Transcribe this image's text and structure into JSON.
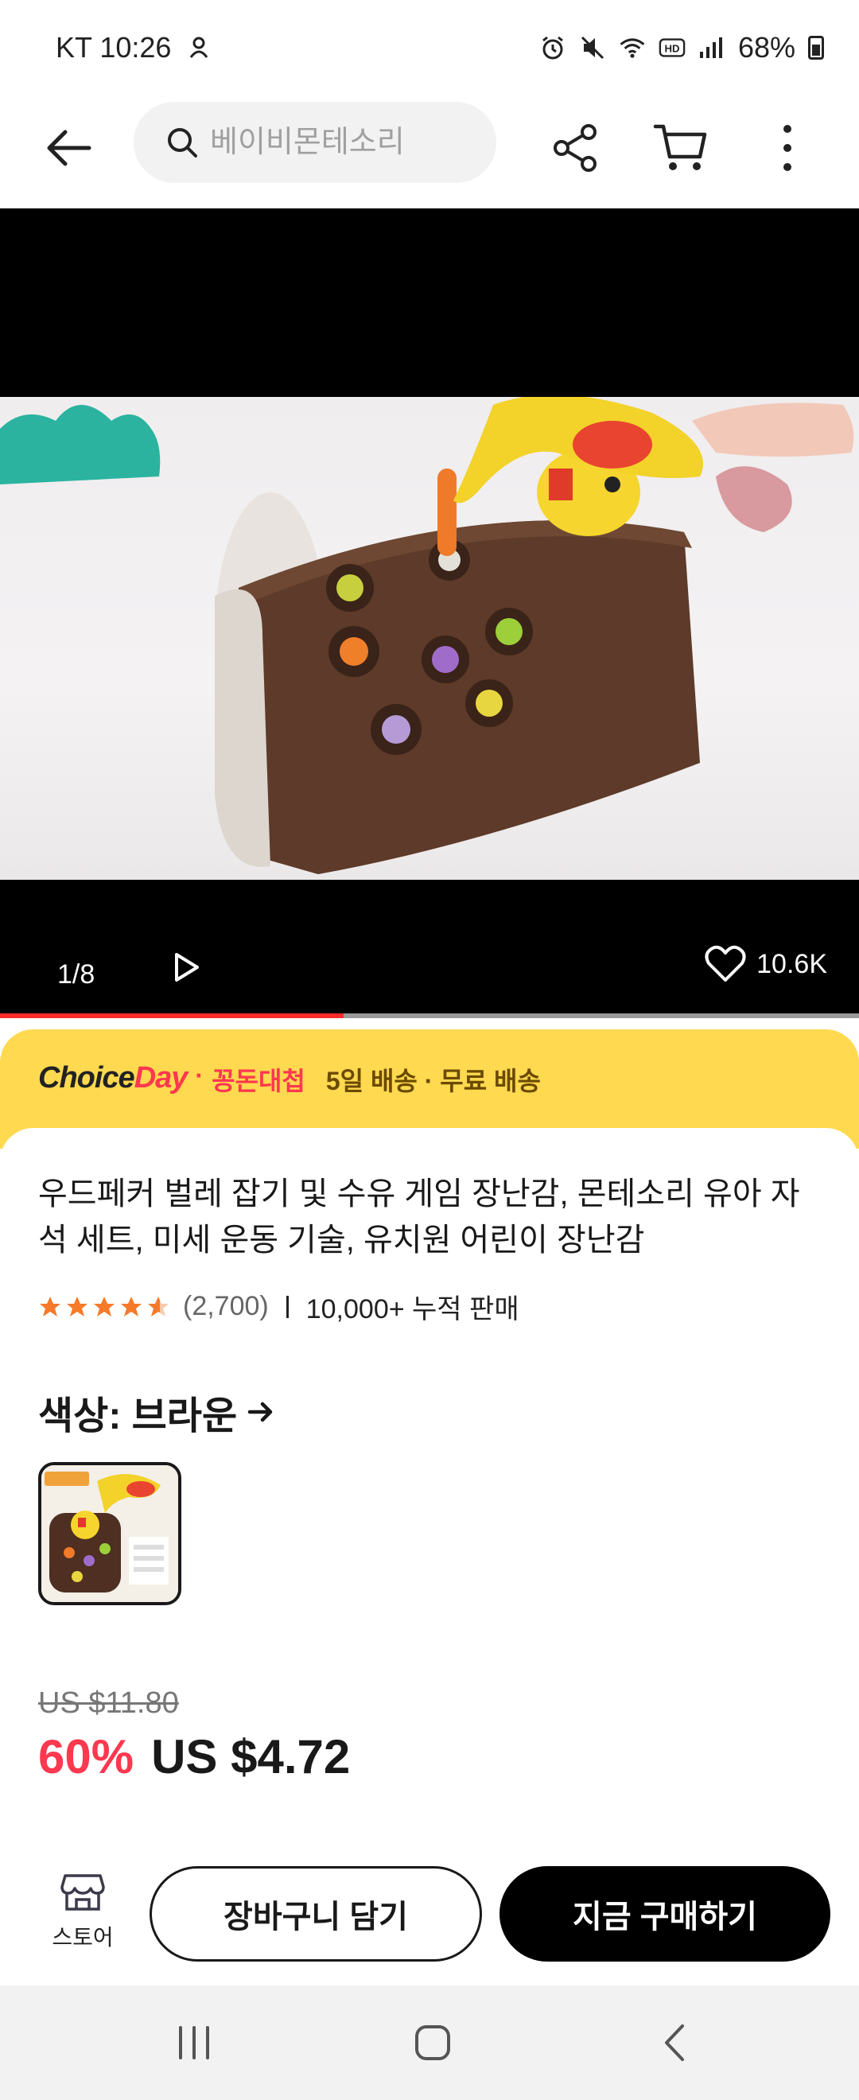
{
  "status_bar": {
    "carrier_time": "KT 10:26",
    "battery": "68%",
    "icons": [
      "alarm-icon",
      "mute-icon",
      "wifi-icon",
      "hd-icon",
      "signal-icon",
      "battery-icon"
    ]
  },
  "header": {
    "search_placeholder": "베이비몬테소리",
    "icons": [
      "back-arrow-icon",
      "search-icon",
      "share-icon",
      "cart-icon",
      "more-vertical-icon"
    ]
  },
  "media": {
    "counter": "1/8",
    "likes": "10.6K",
    "progress_fraction": 0.4
  },
  "banner": {
    "choice": "Choice",
    "day": "Day",
    "promo": "꽁돈대첩",
    "shipping": "5일 배송 · 무료 배송",
    "colors": {
      "bg": "#ffd94f",
      "accent": "#fd384f"
    }
  },
  "product": {
    "title": "우드페커 벌레 잡기 및 수유 게임 장난감, 몬테소리 유아 자석 세트, 미세 운동 기술, 유치원 어린이 장난감",
    "rating_stars": 4.5,
    "reviews": "(2,700)",
    "sold": "10,000+ 누적 판매",
    "color_label": "색상: 브라운",
    "old_price": "US $11.80",
    "discount": "60%",
    "price": "US $4.72"
  },
  "actions": {
    "store": "스토어",
    "add_to_cart": "장바구니 담기",
    "buy_now": "지금 구매하기"
  }
}
